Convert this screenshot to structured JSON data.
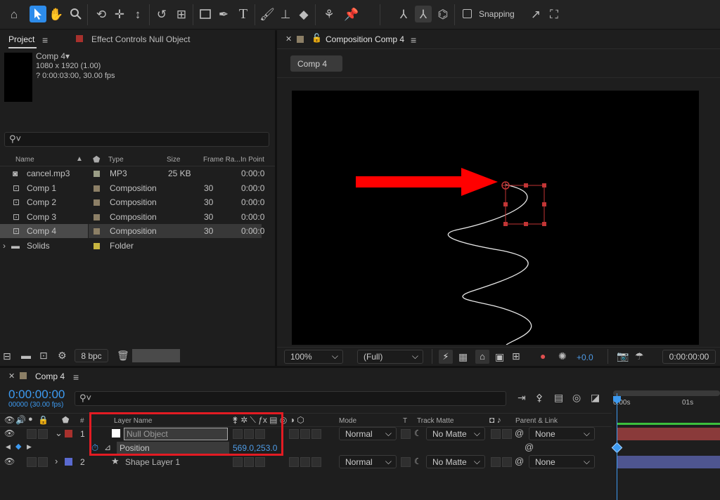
{
  "toolbar": {
    "snapping_label": "Snapping",
    "icons": [
      "home-icon",
      "selection-tool-icon",
      "hand-tool-icon",
      "zoom-tool-icon",
      "orbit-camera-icon",
      "pan-camera-icon",
      "dolly-camera-icon",
      "rotation-tool-icon",
      "pan-behind-icon",
      "rectangle-tool-icon",
      "pen-tool-icon",
      "type-tool-icon",
      "brush-tool-icon",
      "clone-stamp-icon",
      "eraser-tool-icon",
      "roto-brush-icon",
      "puppet-pin-icon"
    ]
  },
  "project_panel": {
    "tab_project": "Project",
    "tab_effect_controls": "Effect Controls Null Object",
    "comp_name": "Comp 4",
    "comp_size": "1080 x 1920 (1.00)",
    "comp_duration": "? 0:00:03:00, 30.00 fps",
    "search_placeholder": "",
    "columns": {
      "name": "Name",
      "type": "Type",
      "size": "Size",
      "frame_rate": "Frame Ra...",
      "in_point": "In Point"
    },
    "items": [
      {
        "name": "cancel.mp3",
        "type": "MP3",
        "size": "25 KB",
        "frame_rate": "",
        "in_point": "0:00:0",
        "color": "#9a9d86",
        "icon": "audio-file-icon"
      },
      {
        "name": "Comp 1",
        "type": "Composition",
        "size": "",
        "frame_rate": "30",
        "in_point": "0:00:0",
        "color": "#8c7f66",
        "icon": "composition-icon"
      },
      {
        "name": "Comp 2",
        "type": "Composition",
        "size": "",
        "frame_rate": "30",
        "in_point": "0:00:0",
        "color": "#8c7f66",
        "icon": "composition-icon"
      },
      {
        "name": "Comp 3",
        "type": "Composition",
        "size": "",
        "frame_rate": "30",
        "in_point": "0:00:0",
        "color": "#8c7f66",
        "icon": "composition-icon"
      },
      {
        "name": "Comp 4",
        "type": "Composition",
        "size": "",
        "frame_rate": "30",
        "in_point": "0:00:0",
        "color": "#8c7f66",
        "icon": "composition-icon",
        "selected": true
      },
      {
        "name": "Solids",
        "type": "Folder",
        "size": "",
        "frame_rate": "",
        "in_point": "",
        "color": "#c7b540",
        "icon": "folder-icon"
      }
    ],
    "bpc_label": "8 bpc"
  },
  "comp_panel": {
    "tab_title": "Composition Comp 4",
    "breadcrumb": "Comp 4",
    "zoom": "100%",
    "resolution": "(Full)",
    "exposure": "+0.0",
    "timecode": "0:00:00:00"
  },
  "timeline": {
    "tab_title": "Comp 4",
    "current_time": "0:00:00:00",
    "frame_info": "00000 (30.00 fps)",
    "search_placeholder": "",
    "columns": {
      "layer_name": "Layer Name",
      "mode": "Mode",
      "t": "T",
      "track_matte": "Track Matte",
      "parent": "Parent & Link"
    },
    "ruler": {
      "start": "0:00s",
      "mark": "01s"
    },
    "layers": [
      {
        "index": "1",
        "name": "Null Object",
        "mode": "Normal",
        "matte": "No Matte",
        "parent": "None",
        "label_color": "#a8312d",
        "bar_color": "#8a3a3a"
      },
      {
        "index": "2",
        "name": "Shape Layer 1",
        "mode": "Normal",
        "matte": "No Matte",
        "parent": "None",
        "label_color": "#5a6ad0",
        "bar_color": "#4e5590"
      }
    ],
    "position_property": {
      "name": "Position",
      "value": "569.0,253.0"
    }
  },
  "colors": {
    "accent": "#2d8ceb",
    "highlight_box": "#e31b23",
    "arrow": "#ff0000"
  }
}
